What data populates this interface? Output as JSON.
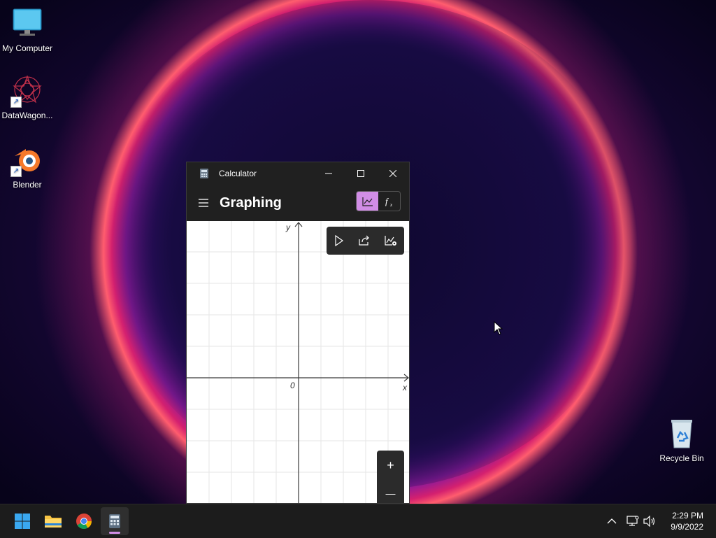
{
  "desktop": {
    "icons": [
      {
        "label": "My Computer"
      },
      {
        "label": "DataWagon..."
      },
      {
        "label": "Blender"
      },
      {
        "label": "Recycle Bin"
      }
    ]
  },
  "calculator": {
    "window_title": "Calculator",
    "mode_title": "Graphing",
    "graph": {
      "y_axis_label": "y",
      "x_axis_label": "x",
      "origin_label": "0"
    },
    "zoom_in_label": "+",
    "zoom_out_label": "—"
  },
  "taskbar": {
    "time": "2:29 PM",
    "date": "9/9/2022"
  },
  "colors": {
    "accent": "#d18de6",
    "window_bg": "#202020",
    "taskbar_bg": "#1c1c1c"
  }
}
